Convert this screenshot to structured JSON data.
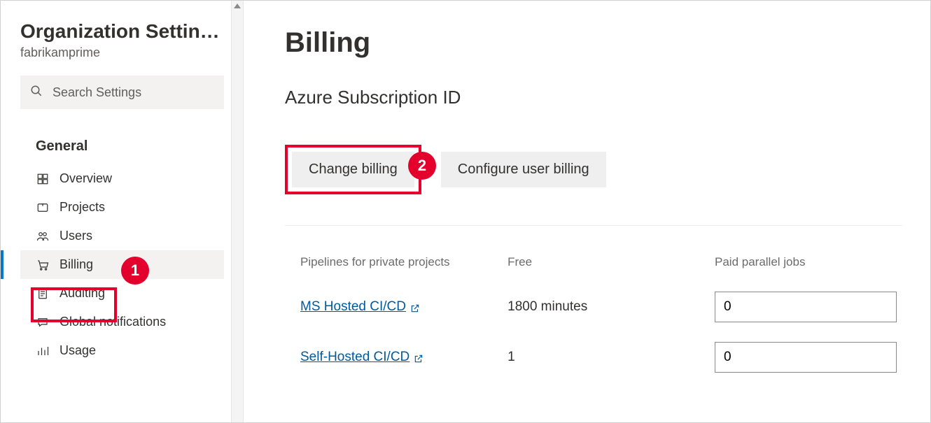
{
  "sidebar": {
    "title": "Organization Settin…",
    "subtitle": "fabrikamprime",
    "search_placeholder": "Search Settings",
    "section_label": "General",
    "items": [
      {
        "label": "Overview",
        "icon": "overview"
      },
      {
        "label": "Projects",
        "icon": "projects"
      },
      {
        "label": "Users",
        "icon": "users"
      },
      {
        "label": "Billing",
        "icon": "billing",
        "active": true
      },
      {
        "label": "Auditing",
        "icon": "auditing"
      },
      {
        "label": "Global notifications",
        "icon": "notifications"
      },
      {
        "label": "Usage",
        "icon": "usage"
      }
    ]
  },
  "main": {
    "title": "Billing",
    "subscription_label": "Azure Subscription ID",
    "buttons": {
      "change_billing": "Change billing",
      "configure_user_billing": "Configure user billing"
    },
    "table": {
      "headers": {
        "pipelines": "Pipelines for private projects",
        "free": "Free",
        "paid": "Paid parallel jobs"
      },
      "rows": [
        {
          "name": "MS Hosted CI/CD",
          "free": "1800 minutes",
          "paid": "0"
        },
        {
          "name": "Self-Hosted CI/CD",
          "free": "1",
          "paid": "0"
        }
      ]
    }
  },
  "callouts": {
    "one": "1",
    "two": "2"
  }
}
